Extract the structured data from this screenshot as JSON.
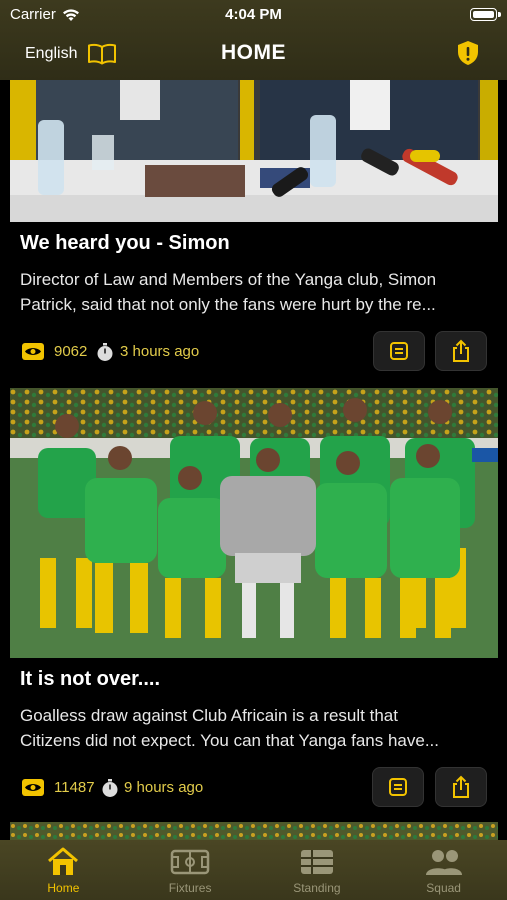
{
  "status_bar": {
    "carrier": "Carrier",
    "time": "4:04 PM"
  },
  "header": {
    "language": "English",
    "title": "HOME"
  },
  "colors": {
    "accent": "#f2c300",
    "meta_text": "#e2cc4b",
    "header_bg": "#3d3a1e",
    "background": "#000000"
  },
  "posts": [
    {
      "title": "We heard you - Simon",
      "description_lines": [
        "Director of Law and Members of the Yanga club, Simon",
        "Patrick, said that not only the fans were hurt by the re..."
      ],
      "views": "9062",
      "time_ago": "3 hours ago"
    },
    {
      "title": "It is not over....",
      "description_lines": [
        "Goalless draw against Club Africain is a result that",
        "Citizens did not expect. You can that Yanga fans have..."
      ],
      "views": "11487",
      "time_ago": "9 hours ago"
    }
  ],
  "tabs": [
    {
      "label": "Home",
      "icon": "home-icon",
      "active": true
    },
    {
      "label": "Fixtures",
      "icon": "pitch-icon",
      "active": false
    },
    {
      "label": "Standing",
      "icon": "table-icon",
      "active": false
    },
    {
      "label": "Squad",
      "icon": "people-icon",
      "active": false
    }
  ]
}
